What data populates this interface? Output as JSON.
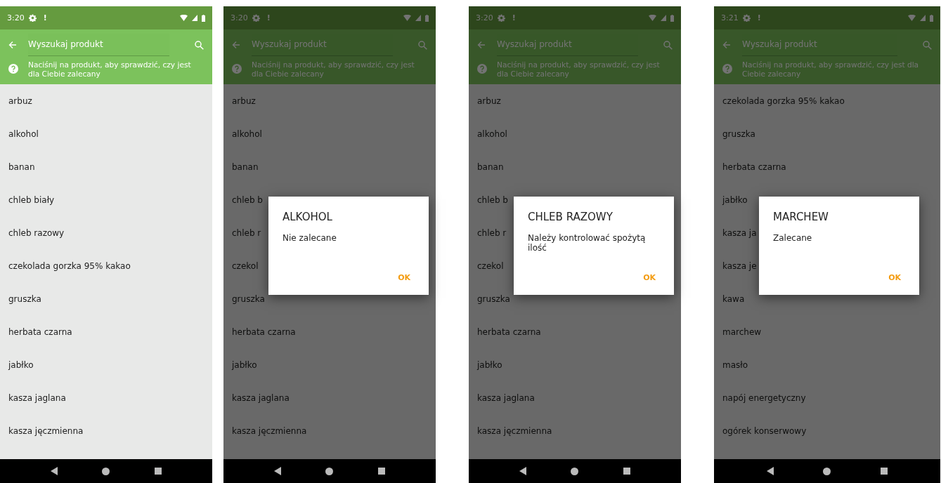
{
  "screens": [
    {
      "status": {
        "time": "3:20",
        "alert": "!"
      },
      "search": {
        "placeholder": "Wyszukaj produkt"
      },
      "hint": "Naciśnij na produkt, aby sprawdzić, czy jest dla Ciebie zalecany",
      "products": [
        "arbuz",
        "alkohol",
        "banan",
        "chleb biały",
        "chleb razowy",
        "czekolada gorzka 95% kakao",
        "gruszka",
        "herbata czarna",
        "jabłko",
        "kasza jaglana",
        "kasza jęczmienna"
      ]
    },
    {
      "status": {
        "time": "3:20",
        "alert": "!"
      },
      "search": {
        "placeholder": "Wyszukaj produkt"
      },
      "hint": "Naciśnij na produkt, aby sprawdzić, czy jest dla Ciebie zalecany",
      "products": [
        "arbuz",
        "alkohol",
        "banan",
        "chleb b",
        "chleb r",
        "czekol",
        "gruszka",
        "herbata czarna",
        "jabłko",
        "kasza jaglana",
        "kasza jęczmienna"
      ],
      "dialog": {
        "title": "ALKOHOL",
        "message": "Nie zalecane",
        "button": "OK"
      }
    },
    {
      "status": {
        "time": "3:20",
        "alert": "!"
      },
      "search": {
        "placeholder": "Wyszukaj produkt"
      },
      "hint": "Naciśnij na produkt, aby sprawdzić, czy jest dla Ciebie zalecany",
      "products": [
        "arbuz",
        "alkohol",
        "banan",
        "chleb b",
        "chleb r",
        "czekol",
        "gruszka",
        "herbata czarna",
        "jabłko",
        "kasza jaglana",
        "kasza jęczmienna"
      ],
      "dialog": {
        "title": "CHLEB RAZOWY",
        "message": "Należy kontrolować spożytą ilość",
        "button": "OK"
      }
    },
    {
      "status": {
        "time": "3:21",
        "alert": "!"
      },
      "search": {
        "placeholder": "Wyszukaj produkt"
      },
      "hint": "Naciśnij na produkt, aby sprawdzić, czy jest dla Ciebie zalecany",
      "products": [
        "czekolada gorzka 95% kakao",
        "gruszka",
        "herbata czarna",
        "jabłko",
        "kasza ja",
        "kasza je",
        "kawa",
        "marchew",
        "masło",
        "napój energetyczny",
        "ogórek konserwowy"
      ],
      "dialog": {
        "title": "MARCHEW",
        "message": "Zalecane",
        "button": "OK"
      }
    }
  ]
}
